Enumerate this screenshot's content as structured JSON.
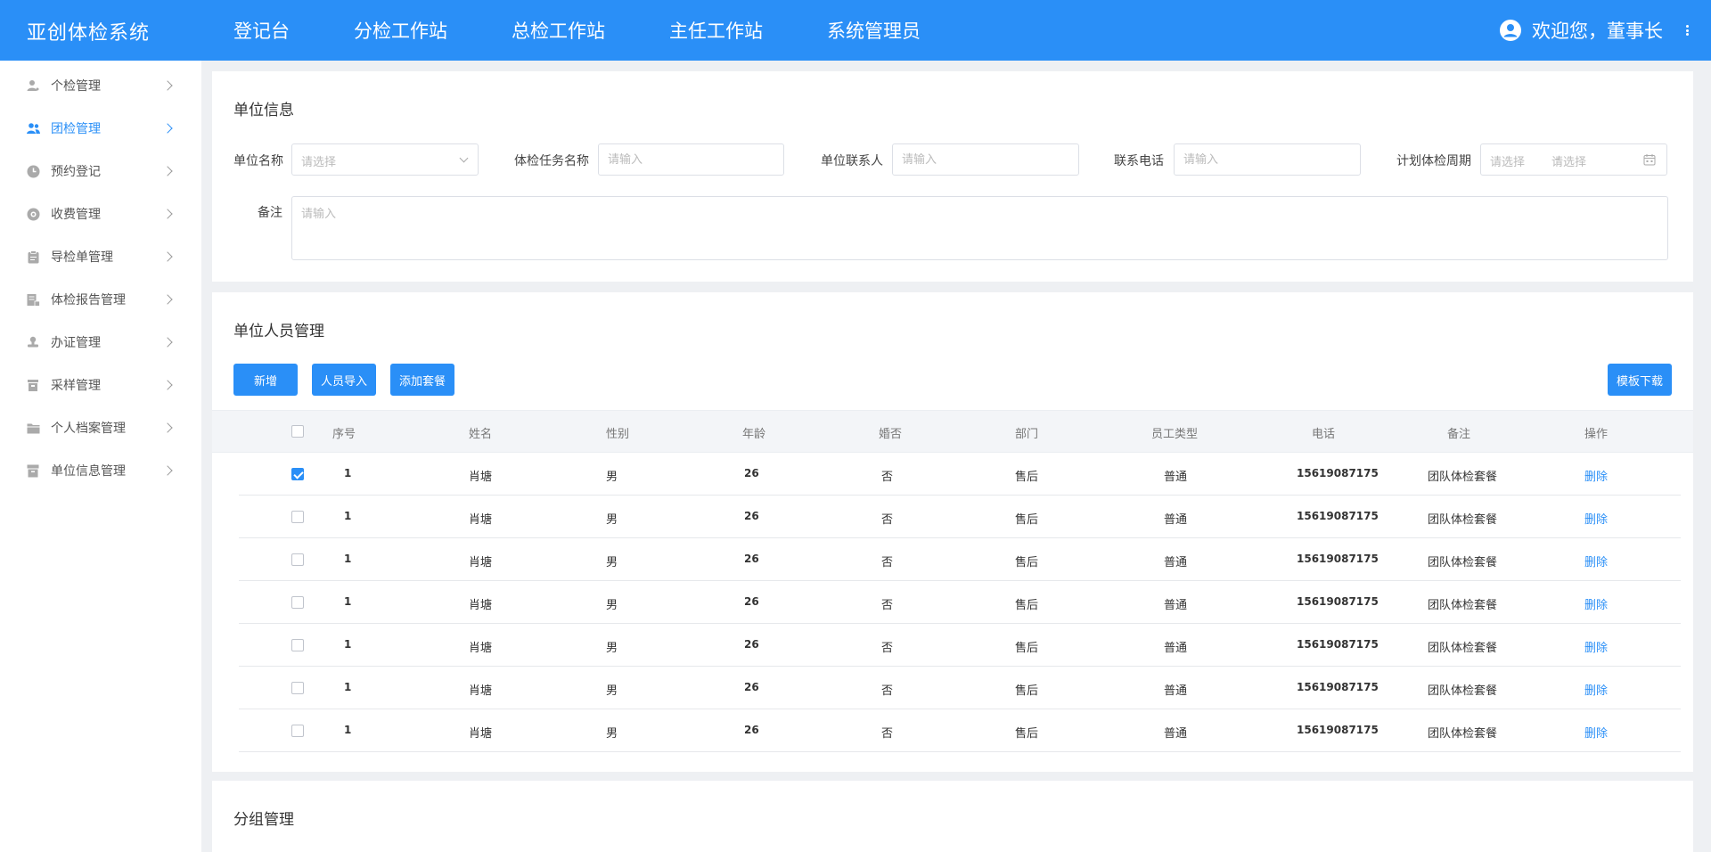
{
  "app": {
    "title": "亚创体检系统"
  },
  "topnav": [
    "登记台",
    "分检工作站",
    "总检工作站",
    "主任工作站",
    "系统管理员"
  ],
  "user": {
    "greeting": "欢迎您，董事长"
  },
  "sidebar": {
    "items": [
      {
        "label": "个检管理",
        "icon": "person-icon"
      },
      {
        "label": "团检管理",
        "icon": "group-icon",
        "active": true
      },
      {
        "label": "预约登记",
        "icon": "clock-icon"
      },
      {
        "label": "收费管理",
        "icon": "coin-icon"
      },
      {
        "label": "导检单管理",
        "icon": "clipboard-icon"
      },
      {
        "label": "体检报告管理",
        "icon": "report-icon"
      },
      {
        "label": "办证管理",
        "icon": "stamp-icon"
      },
      {
        "label": "采样管理",
        "icon": "sample-icon"
      },
      {
        "label": "个人档案管理",
        "icon": "folder-icon"
      },
      {
        "label": "单位信息管理",
        "icon": "archive-icon"
      }
    ]
  },
  "unit_info": {
    "title": "单位信息",
    "unit_name_label": "单位名称",
    "unit_name_placeholder": "请选择",
    "task_name_label": "体检任务名称",
    "task_name_placeholder": "请输入",
    "contact_label": "单位联系人",
    "contact_placeholder": "请输入",
    "phone_label": "联系电话",
    "phone_placeholder": "请输入",
    "period_label": "计划体检周期",
    "period_start_placeholder": "请选择",
    "period_separator": "–",
    "period_end_placeholder": "请选择",
    "remark_label": "备注",
    "remark_placeholder": "请输入"
  },
  "staff": {
    "title": "单位人员管理",
    "buttons": {
      "add": "新增",
      "import": "人员导入",
      "add_package": "添加套餐",
      "template": "模板下载"
    },
    "columns": [
      "序号",
      "姓名",
      "性别",
      "年龄",
      "婚否",
      "部门",
      "员工类型",
      "电话",
      "备注",
      "操作"
    ],
    "rows": [
      {
        "checked": true,
        "no": "1",
        "name": "肖塘",
        "gender": "男",
        "age": "26",
        "married": "否",
        "dept": "售后",
        "type": "普通",
        "phone": "15619087175",
        "remark": "团队体检套餐",
        "action": "删除"
      },
      {
        "checked": false,
        "no": "1",
        "name": "肖塘",
        "gender": "男",
        "age": "26",
        "married": "否",
        "dept": "售后",
        "type": "普通",
        "phone": "15619087175",
        "remark": "团队体检套餐",
        "action": "删除"
      },
      {
        "checked": false,
        "no": "1",
        "name": "肖塘",
        "gender": "男",
        "age": "26",
        "married": "否",
        "dept": "售后",
        "type": "普通",
        "phone": "15619087175",
        "remark": "团队体检套餐",
        "action": "删除"
      },
      {
        "checked": false,
        "no": "1",
        "name": "肖塘",
        "gender": "男",
        "age": "26",
        "married": "否",
        "dept": "售后",
        "type": "普通",
        "phone": "15619087175",
        "remark": "团队体检套餐",
        "action": "删除"
      },
      {
        "checked": false,
        "no": "1",
        "name": "肖塘",
        "gender": "男",
        "age": "26",
        "married": "否",
        "dept": "售后",
        "type": "普通",
        "phone": "15619087175",
        "remark": "团队体检套餐",
        "action": "删除"
      },
      {
        "checked": false,
        "no": "1",
        "name": "肖塘",
        "gender": "男",
        "age": "26",
        "married": "否",
        "dept": "售后",
        "type": "普通",
        "phone": "15619087175",
        "remark": "团队体检套餐",
        "action": "删除"
      },
      {
        "checked": false,
        "no": "1",
        "name": "肖塘",
        "gender": "男",
        "age": "26",
        "married": "否",
        "dept": "售后",
        "type": "普通",
        "phone": "15619087175",
        "remark": "团队体检套餐",
        "action": "删除"
      }
    ]
  },
  "group": {
    "title": "分组管理"
  },
  "colors": {
    "primary": "#2a8ff7",
    "background": "#eef0f3"
  }
}
